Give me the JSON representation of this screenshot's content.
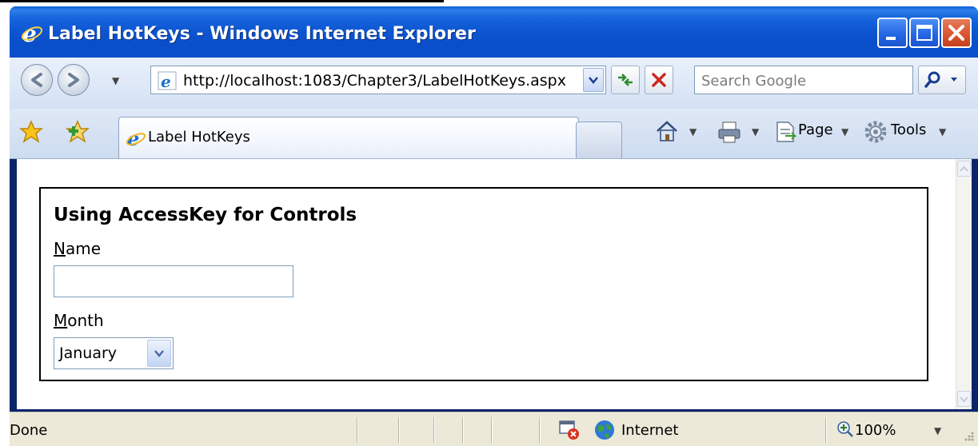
{
  "window": {
    "title": "Label HotKeys - Windows Internet Explorer"
  },
  "navbar": {
    "address": "http://localhost:1083/Chapter3/LabelHotKeys.aspx",
    "search_placeholder": "Search Google"
  },
  "toolbar": {
    "tab_label": "Label HotKeys",
    "page_label": "Page",
    "tools_label": "Tools"
  },
  "page": {
    "heading": "Using AccessKey for Controls",
    "name_label_key": "N",
    "name_label_rest": "ame",
    "name_value": "",
    "month_label_key": "M",
    "month_label_rest": "onth",
    "month_selected": "January"
  },
  "status": {
    "text": "Done",
    "zone": "Internet",
    "zoom": "100%"
  },
  "icons": [
    "ie-logo-icon",
    "minimize-icon",
    "maximize-icon",
    "close-icon",
    "back-icon",
    "forward-icon",
    "refresh-icon",
    "stop-icon",
    "search-icon",
    "favorites-star-icon",
    "add-favorites-icon",
    "home-icon",
    "print-icon",
    "page-icon",
    "tools-gear-icon",
    "globe-icon",
    "popup-blocked-icon",
    "zoom-icon"
  ]
}
